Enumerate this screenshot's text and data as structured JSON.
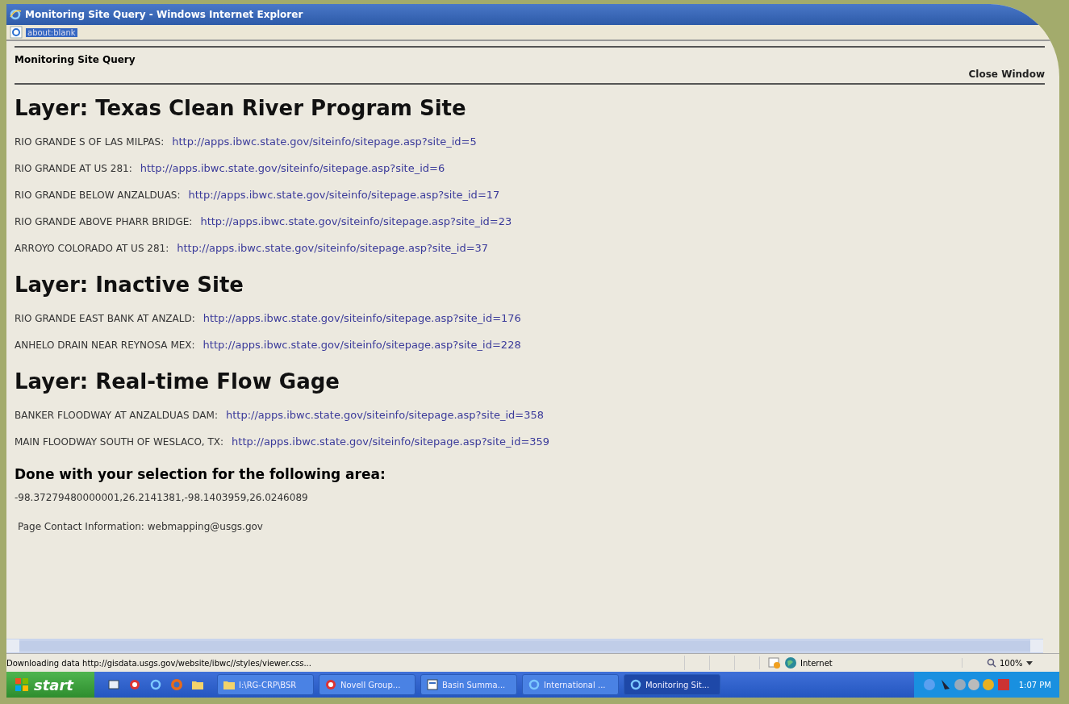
{
  "window": {
    "title": "Monitoring Site Query - Windows Internet Explorer"
  },
  "address_bar": {
    "value": "about:blank"
  },
  "page": {
    "header": "Monitoring Site Query",
    "close_link": "Close Window",
    "layers": [
      {
        "title": "Layer: Texas Clean River Program Site",
        "sites": [
          {
            "name": "RIO GRANDE S OF LAS MILPAS:",
            "url": "http://apps.ibwc.state.gov/siteinfo/sitepage.asp?site_id=5"
          },
          {
            "name": "RIO GRANDE AT US 281:",
            "url": "http://apps.ibwc.state.gov/siteinfo/sitepage.asp?site_id=6"
          },
          {
            "name": "RIO GRANDE BELOW ANZALDUAS:",
            "url": "http://apps.ibwc.state.gov/siteinfo/sitepage.asp?site_id=17"
          },
          {
            "name": "RIO GRANDE ABOVE PHARR BRIDGE:",
            "url": "http://apps.ibwc.state.gov/siteinfo/sitepage.asp?site_id=23"
          },
          {
            "name": "ARROYO COLORADO AT US 281:",
            "url": "http://apps.ibwc.state.gov/siteinfo/sitepage.asp?site_id=37"
          }
        ]
      },
      {
        "title": "Layer: Inactive Site",
        "sites": [
          {
            "name": "RIO GRANDE EAST BANK AT ANZALD:",
            "url": "http://apps.ibwc.state.gov/siteinfo/sitepage.asp?site_id=176"
          },
          {
            "name": "ANHELO DRAIN NEAR REYNOSA MEX:",
            "url": "http://apps.ibwc.state.gov/siteinfo/sitepage.asp?site_id=228"
          }
        ]
      },
      {
        "title": "Layer: Real-time Flow Gage",
        "sites": [
          {
            "name": "BANKER FLOODWAY AT ANZALDUAS DAM:",
            "url": "http://apps.ibwc.state.gov/siteinfo/sitepage.asp?site_id=358"
          },
          {
            "name": "MAIN FLOODWAY SOUTH OF WESLACO, TX:",
            "url": "http://apps.ibwc.state.gov/siteinfo/sitepage.asp?site_id=359"
          }
        ]
      }
    ],
    "done_heading": "Done with your selection for the following area:",
    "coordinates": "-98.37279480000001,26.2141381,-98.1403959,26.0246089",
    "contact": "Page Contact Information: webmapping@usgs.gov"
  },
  "status_bar": {
    "message": "Downloading data http://gisdata.usgs.gov/website/ibwc//styles/viewer.css...",
    "zone": "Internet",
    "zoom": "100%"
  },
  "taskbar": {
    "start": "start",
    "tasks": [
      {
        "label": "I:\\RG-CRP\\BSR",
        "kind": "folder",
        "selected": false
      },
      {
        "label": "Novell Group...",
        "kind": "app",
        "selected": false
      },
      {
        "label": "Basin Summa...",
        "kind": "document",
        "selected": false
      },
      {
        "label": "International ...",
        "kind": "browser",
        "selected": false
      },
      {
        "label": "Monitoring Sit...",
        "kind": "browser",
        "selected": true
      }
    ],
    "clock": "1:07 PM"
  }
}
